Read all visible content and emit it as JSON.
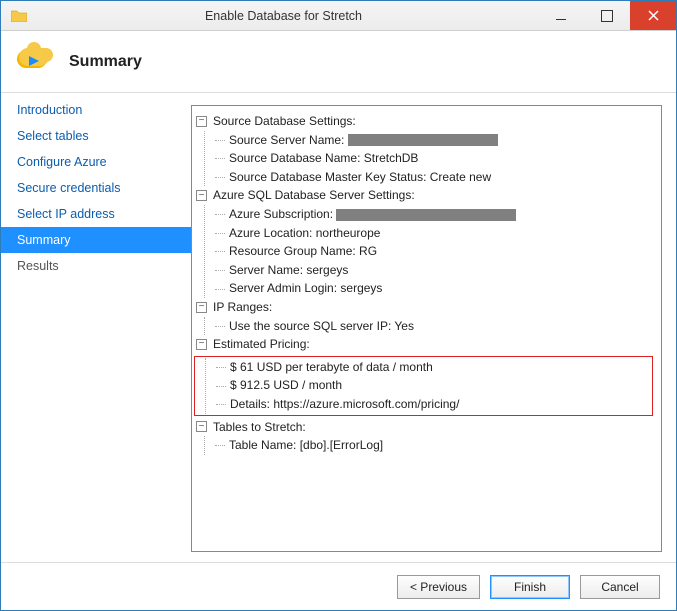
{
  "window": {
    "title": "Enable Database for Stretch"
  },
  "header": {
    "title": "Summary"
  },
  "sidebar": {
    "items": [
      {
        "label": "Introduction"
      },
      {
        "label": "Select tables"
      },
      {
        "label": "Configure Azure"
      },
      {
        "label": "Secure credentials"
      },
      {
        "label": "Select IP address"
      },
      {
        "label": "Summary"
      },
      {
        "label": "Results"
      }
    ]
  },
  "tree": {
    "sourceDb": {
      "label": "Source Database Settings:",
      "serverNameLabel": "Source Server Name:",
      "dbName": "Source Database Name: StretchDB",
      "masterKey": "Source Database Master Key Status: Create new"
    },
    "azure": {
      "label": "Azure SQL Database Server Settings:",
      "subscriptionLabel": "Azure Subscription:",
      "location": "Azure Location: northeurope",
      "rg": "Resource Group Name: RG",
      "serverName": "Server Name: sergeys",
      "adminLogin": "Server Admin Login: sergeys"
    },
    "ip": {
      "label": "IP Ranges:",
      "useSource": "Use the source SQL server IP: Yes"
    },
    "pricing": {
      "label": "Estimated Pricing:",
      "perTb": "$ 61 USD per terabyte of data / month",
      "perMonth": "$ 912.5 USD / month",
      "details": "Details: https://azure.microsoft.com/pricing/"
    },
    "tables": {
      "label": "Tables to Stretch:",
      "table": "Table Name: [dbo].[ErrorLog]"
    }
  },
  "footer": {
    "previous": "< Previous",
    "finish": "Finish",
    "cancel": "Cancel"
  }
}
